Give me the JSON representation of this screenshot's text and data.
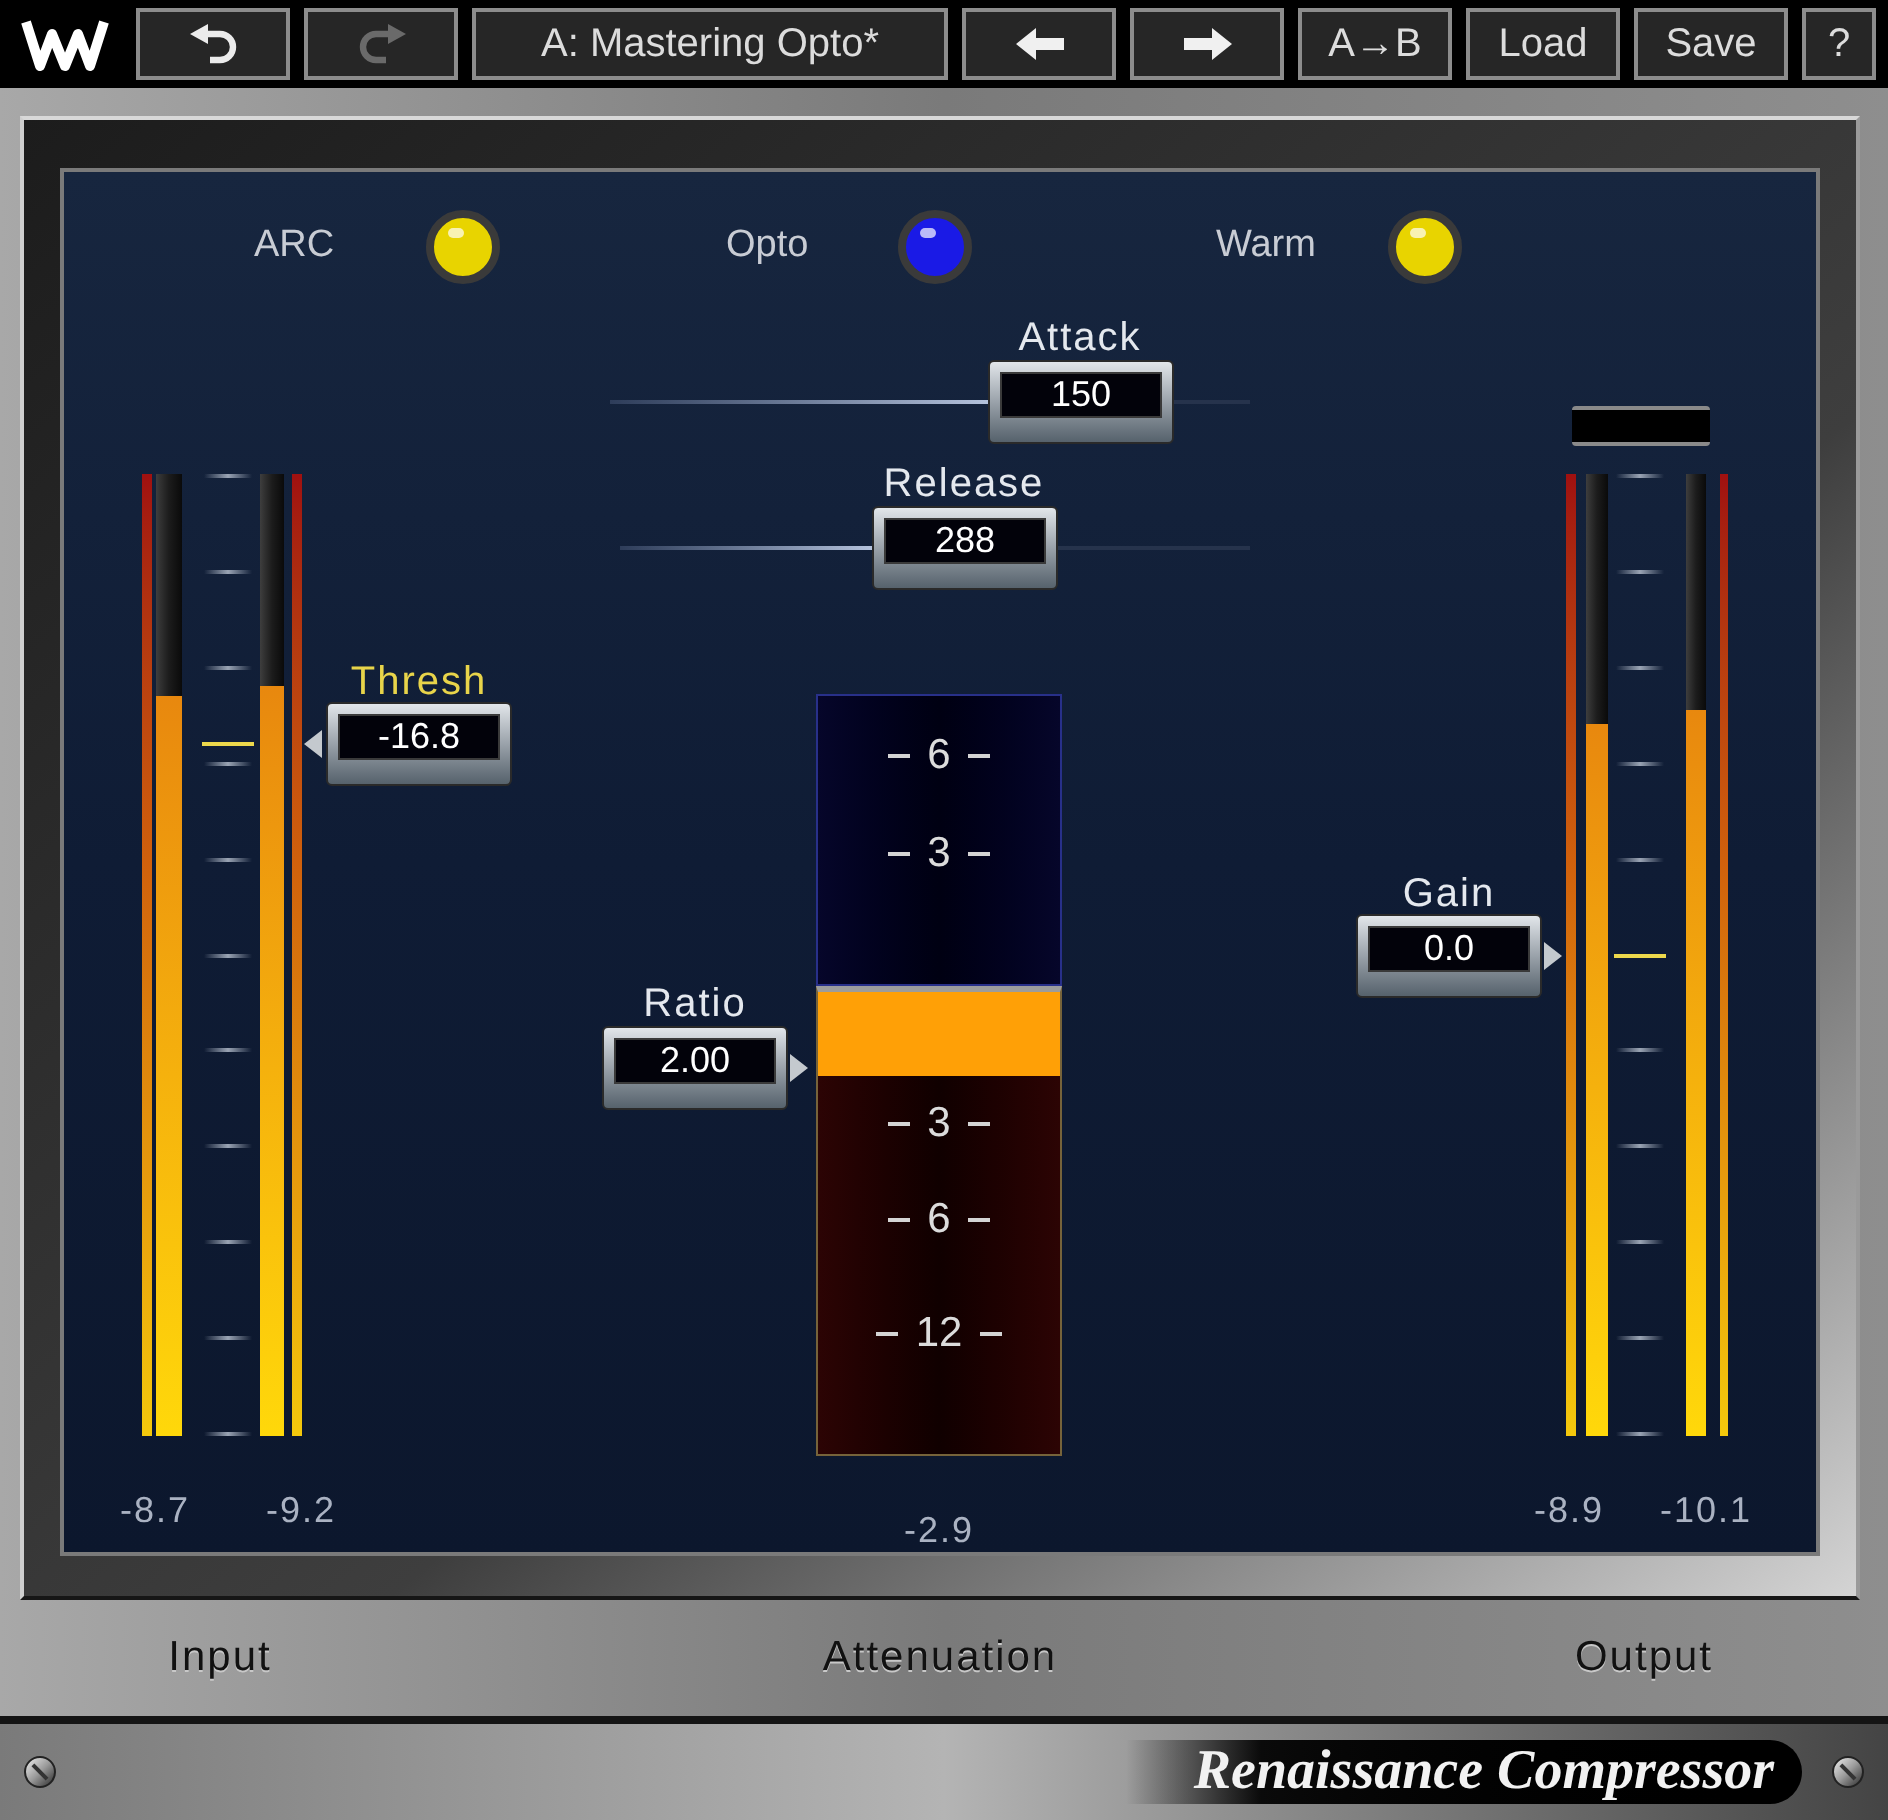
{
  "toolbar": [
    {
      "kind": "undo",
      "disabled": false
    },
    {
      "kind": "redo",
      "disabled": true
    },
    {
      "kind": "preset",
      "label": "A: Mastering Opto*"
    },
    {
      "kind": "previous"
    },
    {
      "kind": "next"
    },
    {
      "kind": "label",
      "label": "A→B"
    },
    {
      "kind": "label",
      "label": "Load"
    },
    {
      "kind": "label",
      "label": "Save"
    },
    {
      "kind": "label",
      "label": "?"
    }
  ],
  "mode_leds": [
    {
      "label": "ARC",
      "color": "#e8d400"
    },
    {
      "label": "Opto",
      "color": "#1a1ae6"
    },
    {
      "label": "Warm",
      "color": "#e8d400"
    }
  ],
  "time_sliders": [
    {
      "label": "Attack",
      "value": "150",
      "level": 0.59
    },
    {
      "label": "Release",
      "value": "288",
      "level": 0.4
    }
  ],
  "input": {
    "label": "Input",
    "meters": [
      {
        "level": 0.77,
        "reading": "-8.7"
      },
      {
        "level": 0.78,
        "reading": "-9.2"
      }
    ],
    "threshold": {
      "label": "Thresh",
      "value": "-16.8",
      "level": 0.72
    }
  },
  "attenuation": {
    "label": "Attenuation",
    "scale_upper": [
      "6",
      "3"
    ],
    "scale_lower": [
      "3",
      "6",
      "12"
    ],
    "level": 0.18,
    "reading": "-2.9",
    "ratio": {
      "label": "Ratio",
      "value": "2.00"
    }
  },
  "output": {
    "label": "Output",
    "meters": [
      {
        "level": 0.74,
        "reading": "-8.9"
      },
      {
        "level": 0.755,
        "reading": "-10.1"
      }
    ],
    "gain": {
      "label": "Gain",
      "value": "0.0",
      "level": 0.5
    }
  },
  "product_name": "Renaissance Compressor"
}
